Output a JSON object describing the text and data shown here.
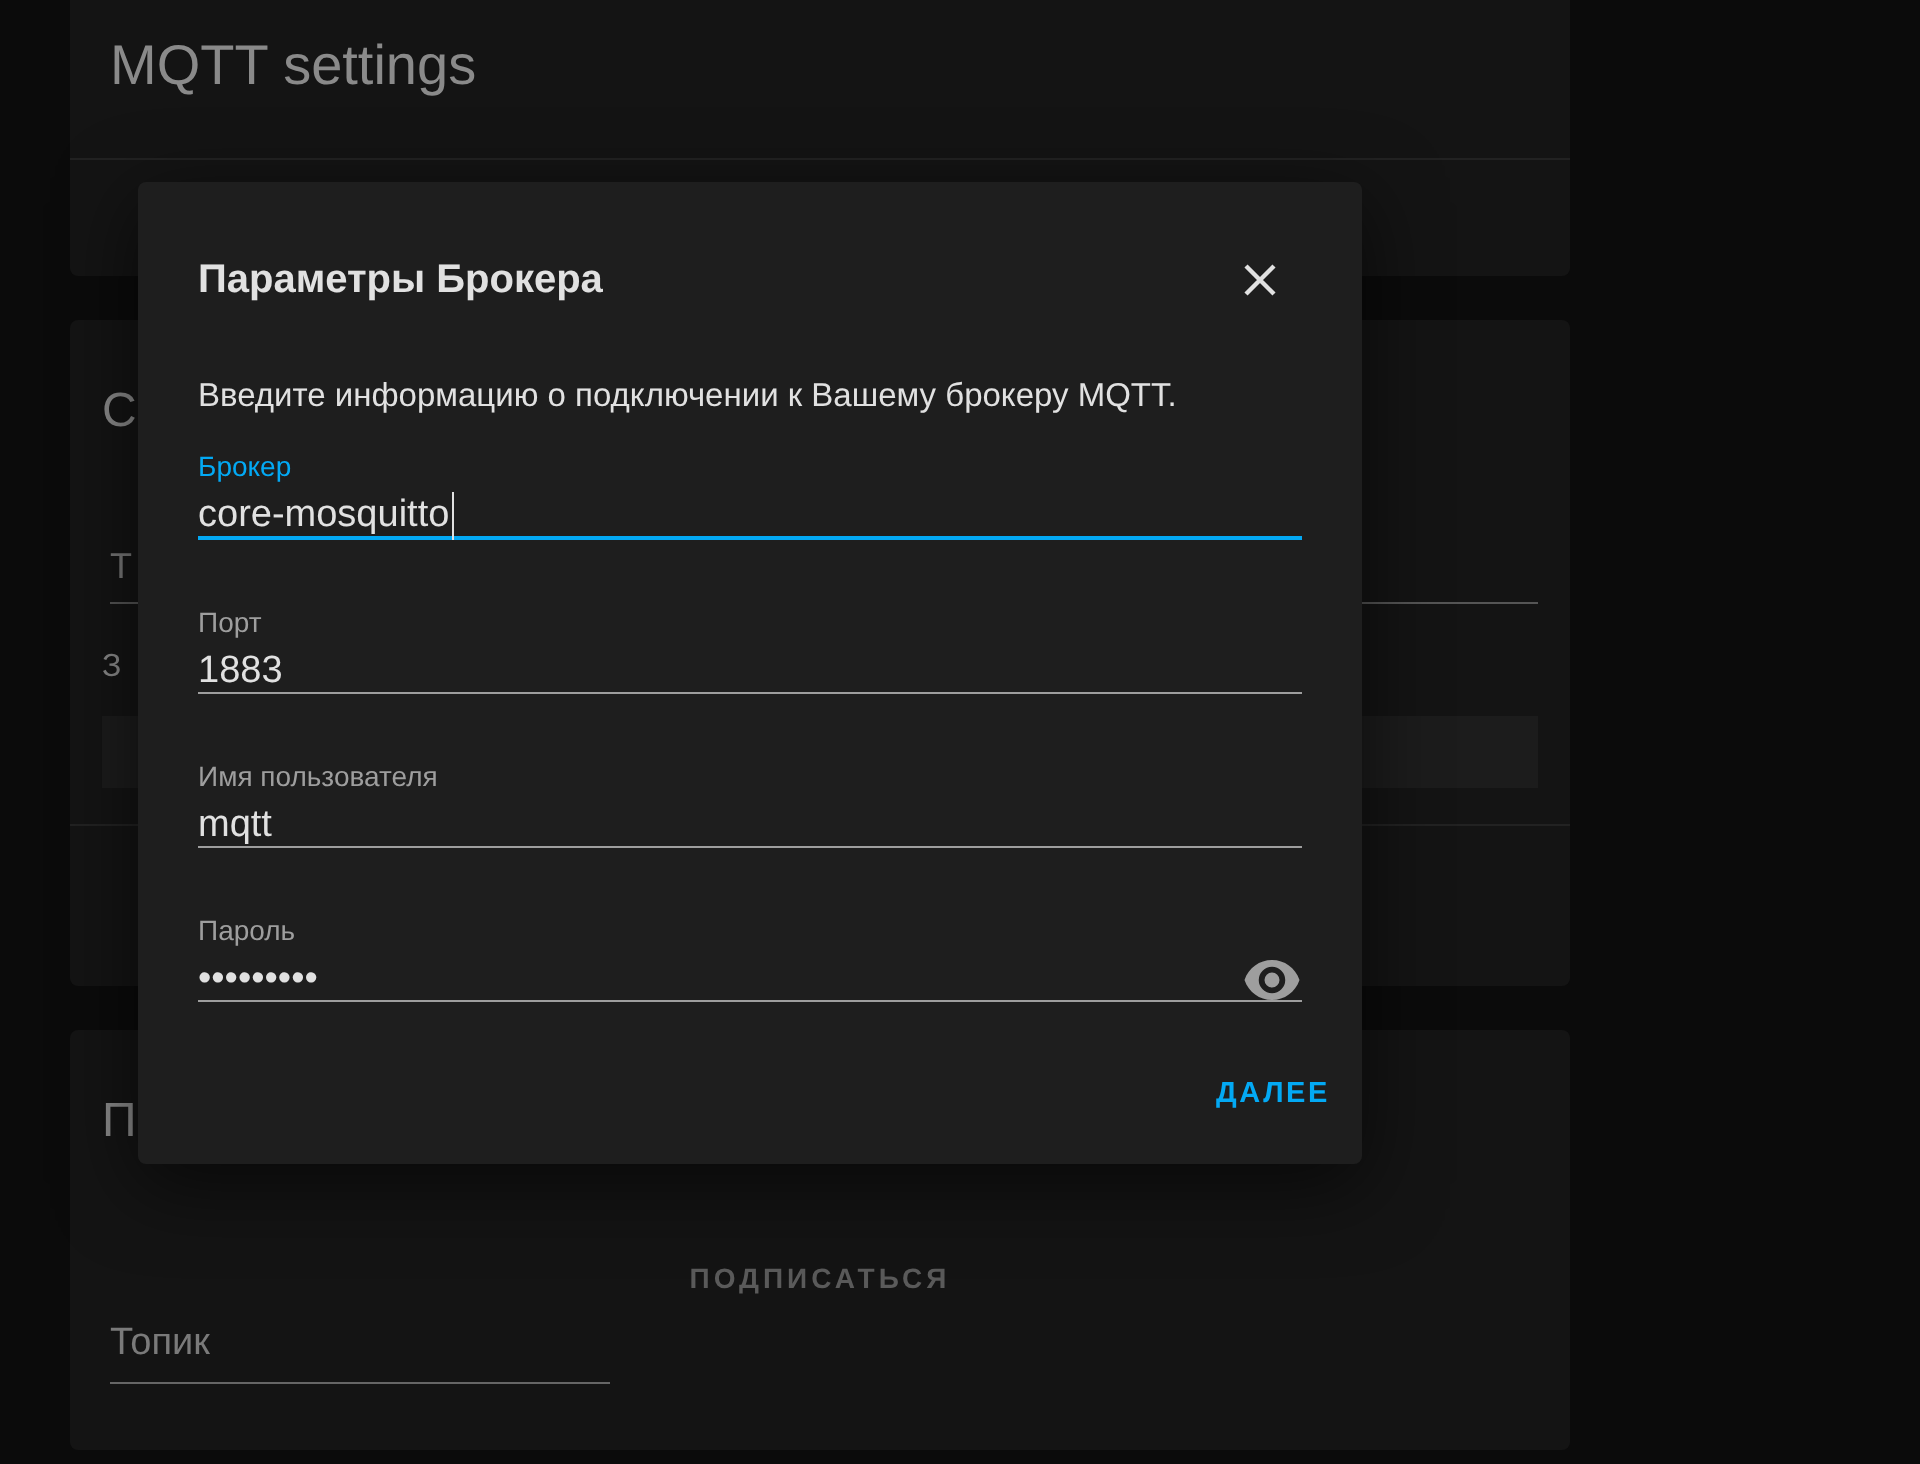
{
  "page": {
    "title": "MQTT settings",
    "card2_title": "С",
    "card2_field": "Т",
    "card2_label": "З",
    "card3_title": "П",
    "subscribe_button": "ПОДПИСАТЬСЯ",
    "topic_field": {
      "placeholder": "Топик"
    }
  },
  "dialog": {
    "title": "Параметры Брокера",
    "description": "Введите информацию о подключении к Вашему брокеру MQTT.",
    "fields": [
      {
        "kind": "text",
        "label": "Брокер",
        "value": "core-mosquitto",
        "focused": true
      },
      {
        "kind": "text",
        "label": "Порт",
        "value": "1883",
        "focused": false
      },
      {
        "kind": "text",
        "label": "Имя пользователя",
        "value": "mqtt",
        "focused": false
      },
      {
        "kind": "password",
        "label": "Пароль",
        "value": "•••••••••",
        "focused": false
      }
    ],
    "next_button": "ДАЛЕЕ"
  }
}
